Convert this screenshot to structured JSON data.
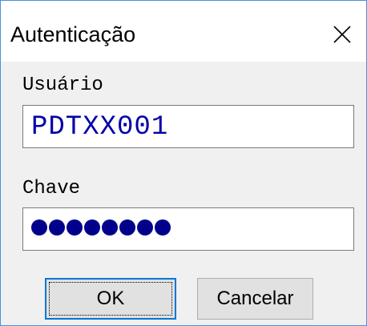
{
  "window": {
    "title": "Autenticação",
    "close_icon": "close-icon"
  },
  "form": {
    "user_label": "Usuário",
    "user_value": "PDTXX001",
    "key_label": "Chave",
    "key_mask_count": 8
  },
  "buttons": {
    "ok_label": "OK",
    "cancel_label": "Cancelar"
  },
  "colors": {
    "window_border": "#4a90e2",
    "field_text": "#0000a8",
    "focus_border": "#0078d7"
  }
}
